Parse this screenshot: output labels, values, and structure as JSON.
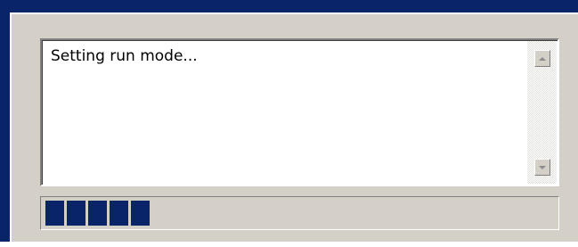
{
  "log": {
    "text": "Setting run mode..."
  },
  "progress": {
    "value_fraction": 0.2,
    "blocks_filled": 5,
    "block_color": "#0a246a"
  },
  "colors": {
    "window_frame": "#0a246a",
    "face": "#d4d0c8"
  },
  "icons": {
    "scroll_up": "scroll-up-arrow",
    "scroll_down": "scroll-down-arrow"
  }
}
